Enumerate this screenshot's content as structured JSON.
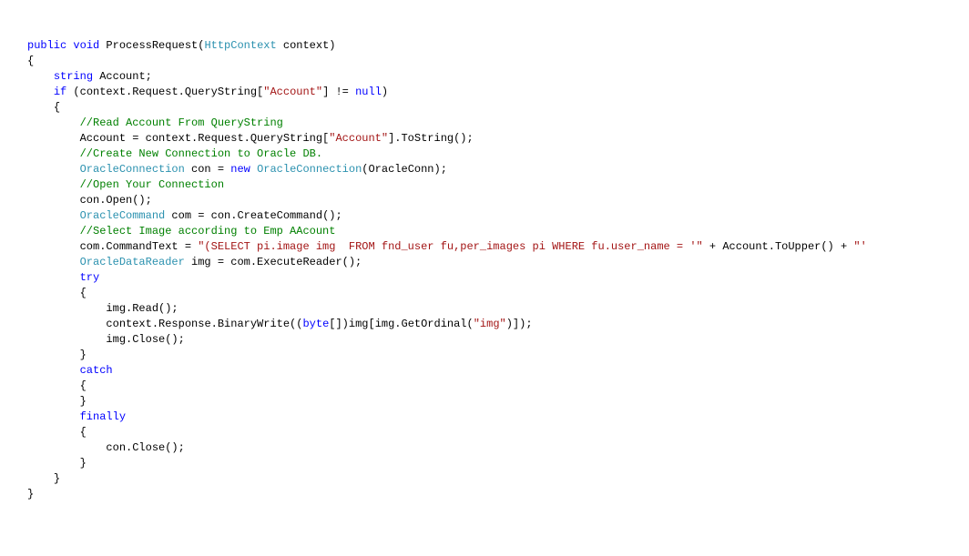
{
  "code": {
    "l1": {
      "kw1": "public",
      "kw2": "void",
      "name": " ProcessRequest(",
      "type": "HttpContext",
      "param": " context)"
    },
    "l2": "{",
    "l3": {
      "kw1": "string",
      "rest": " Account;"
    },
    "l4": {
      "kw1": "if",
      "a": " (context.Request.QueryString[",
      "str": "\"Account\"",
      "b": "] != ",
      "kw2": "null",
      "c": ")"
    },
    "l5": "{",
    "l6": "//Read Account From QueryString",
    "l7": {
      "a": "Account = context.Request.QueryString[",
      "str": "\"Account\"",
      "b": "].ToString();"
    },
    "l8": "//Create New Connection to Oracle DB.",
    "l9": {
      "type1": "OracleConnection",
      "a": " con = ",
      "kw": "new",
      "b": " ",
      "type2": "OracleConnection",
      "c": "(OracleConn);"
    },
    "l10": "//Open Your Connection",
    "l11": "con.Open();",
    "l12": {
      "type": "OracleCommand",
      "rest": " com = con.CreateCommand();"
    },
    "l13": "//Select Image according to Emp AAcount",
    "l14": {
      "a": "com.CommandText = ",
      "str": "\"(SELECT pi.image img  FROM fnd_user fu,per_images pi WHERE fu.user_name = '\"",
      "b": " + Account.ToUpper() + ",
      "str2": "\"'"
    },
    "l15": {
      "type": "OracleDataReader",
      "rest": " img = com.ExecuteReader();"
    },
    "l16": "try",
    "l17": "{",
    "l18": "img.Read();",
    "l19": {
      "a": "context.Response.BinaryWrite((",
      "kw": "byte",
      "b": "[])img[img.GetOrdinal(",
      "str": "\"img\"",
      "c": ")]);"
    },
    "l20": "img.Close();",
    "l21": "}",
    "l22": "catch",
    "l23": "{",
    "l24": "}",
    "l25": "finally",
    "l26": "{",
    "l27": "con.Close();",
    "l28": "}",
    "l29": "}",
    "l30": "}"
  }
}
